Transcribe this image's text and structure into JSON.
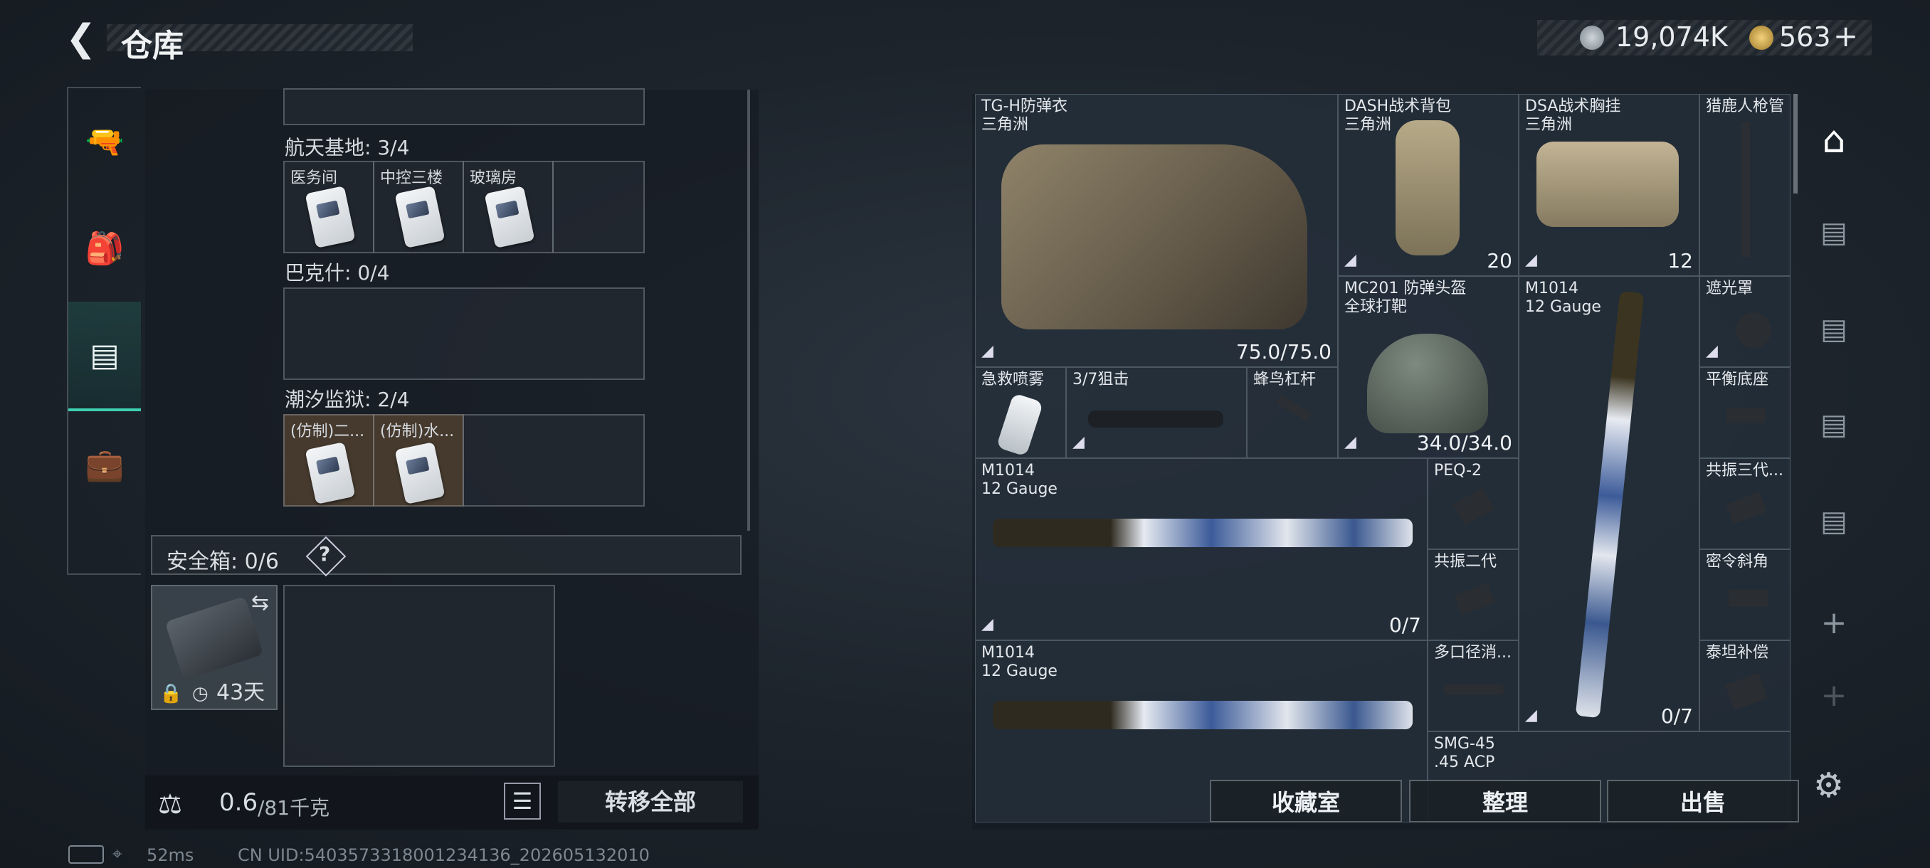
{
  "header": {
    "back_icon": "back-arrow-icon",
    "title": "仓库"
  },
  "currency": {
    "coins": "19,074K",
    "premium": "563",
    "plus": "+"
  },
  "left_nav": [
    "gun-icon",
    "backpack-icon",
    "container-icon",
    "briefcase-icon"
  ],
  "stash": {
    "sections": [
      {
        "label": "航天基地: 3/4",
        "cells": [
          "医务间",
          "中控三楼",
          "玻璃房",
          ""
        ]
      },
      {
        "label": "巴克什: 0/4",
        "cells": [
          "",
          "",
          "",
          ""
        ]
      },
      {
        "label": "潮汐监狱: 2/4",
        "cells": [
          "(仿制)二...",
          "(仿制)水...",
          "",
          ""
        ]
      }
    ],
    "safe_box": {
      "label": "安全箱: 0/6",
      "help": "?",
      "duration": "43天"
    }
  },
  "footer_left": {
    "weight": "0.6",
    "capacity": "/81千克",
    "transfer_all": "转移全部"
  },
  "items": {
    "vest": {
      "name": "TG-H防弹衣\n三角洲",
      "value": "75.0/75.0"
    },
    "backpack": {
      "name": "DASH战术背包\n三角洲",
      "value": "20"
    },
    "chest_rig": {
      "name": "DSA战术胸挂\n三角洲",
      "value": "12"
    },
    "barrel": {
      "name": "猎鹿人枪管"
    },
    "helmet": {
      "name": "MC201 防弹头盔\n全球打靶",
      "value": "34.0/34.0"
    },
    "m1014_vert": {
      "name": "M1014\n12 Gauge",
      "value": "0/7"
    },
    "hood": {
      "name": "遮光罩"
    },
    "spray": {
      "name": "急救喷雾"
    },
    "scope": {
      "name": "3/7狙击"
    },
    "lever": {
      "name": "蜂鸟杠杆"
    },
    "balance": {
      "name": "平衡底座"
    },
    "m1014_a": {
      "name": "M1014\n12 Gauge",
      "value": "0/7"
    },
    "peq": {
      "name": "PEQ-2"
    },
    "resonance3": {
      "name": "共振三代..."
    },
    "resonance2": {
      "name": "共振二代"
    },
    "secret": {
      "name": "密令斜角"
    },
    "m1014_b": {
      "name": "M1014\n12 Gauge"
    },
    "multi": {
      "name": "多口径消..."
    },
    "titan": {
      "name": "泰坦补偿"
    },
    "smg": {
      "name": "SMG-45\n.45 ACP"
    }
  },
  "actions": {
    "collection": "收藏室",
    "sort": "整理",
    "sell": "出售"
  },
  "right_nav": [
    "home-icon",
    "stash-v-icon",
    "stash-iv-icon",
    "stash-ii-add-icon",
    "stash-iv-b-icon",
    "add-icon",
    "add-icon",
    "settings-icon"
  ],
  "status": {
    "ping": "52ms",
    "uid": "CN UID:5403573318001234136_202605132010"
  }
}
